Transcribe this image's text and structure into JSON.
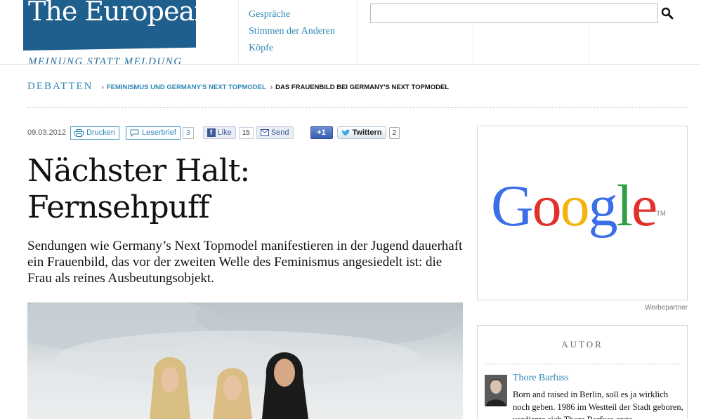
{
  "header": {
    "logo": "The European",
    "tagline": "MEINUNG STATT MELDUNG",
    "nav": [
      "Gespräche",
      "Stimmen der Anderen",
      "Köpfe"
    ],
    "search": {
      "value": "",
      "placeholder": ""
    }
  },
  "breadcrumb": {
    "root": "DEBATTEN",
    "separator": "›",
    "level1": "FEMINISMUS UND GERMANY'S NEXT TOPMODEL",
    "level2": "DAS FRAUENBILD BEI GERMANY'S NEXT TOPMODEL"
  },
  "toolbar": {
    "date": "09.03.2012",
    "print_label": "Drucken",
    "letter_label": "Leserbrief",
    "letter_count": "3",
    "like_label": "Like",
    "like_count": "15",
    "send_label": "Send",
    "gplus_label": "+1",
    "twitter_label": "Twittern",
    "twitter_count": "2"
  },
  "article": {
    "headline_line1": "Nächster Halt:",
    "headline_line2": "Fernsehpuff",
    "lead": "Sendungen wie Germany’s Next Topmodel manifestieren in der Jugend dauerhaft ein Frauenbild, das vor der zweiten Welle des Feminismus angesiedelt ist: die Frau als reines Ausbeutungsobjekt."
  },
  "sidebar": {
    "ad": {
      "brand": "Google",
      "caption": "Werbepartner"
    },
    "author": {
      "heading": "AUTOR",
      "name": "Thore Barfuss",
      "bio": "Born and raised in Berlin, soll es ja wirklich noch geben. 1986 im Westteil der Stadt geboren, verdiente sich Thore Barfuss erste"
    }
  },
  "colors": {
    "brand_blue": "#1f5f8d",
    "link_blue": "#2f86b7",
    "google_blue": "#3b6ee8",
    "google_red": "#e0312b",
    "google_yellow": "#f2b40a",
    "google_green": "#2fa045"
  }
}
